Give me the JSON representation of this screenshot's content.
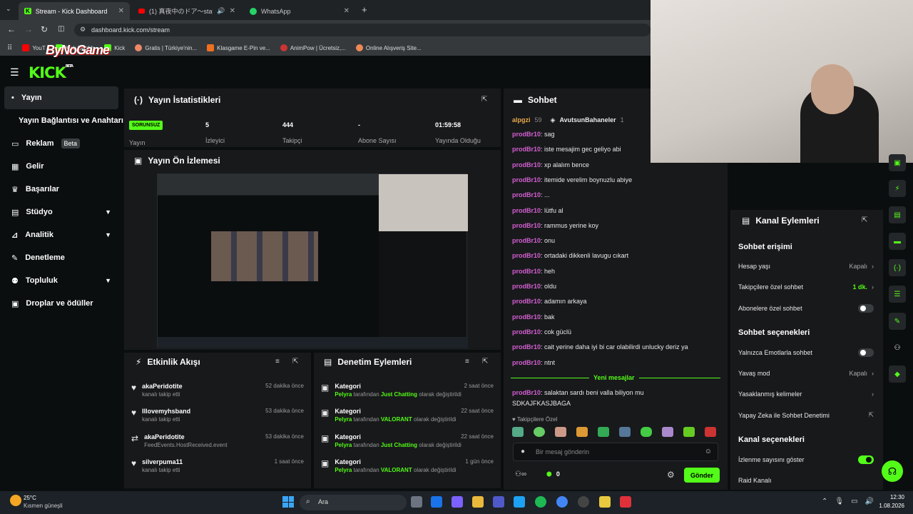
{
  "browser": {
    "tabs": [
      {
        "title": "Stream - Kick Dashboard"
      },
      {
        "title": "(1) 真夜中のドア〜stay with m"
      },
      {
        "title": "WhatsApp"
      }
    ],
    "url": "dashboard.kick.com/stream",
    "bookmarks": [
      "YouT",
      "Kick Dashb",
      "Kick",
      "Gratis | Türkiye'nin...",
      "Klasgame E-Pin ve...",
      "AnimPow | Ücretsiz,...",
      "Online Alışveriş Site..."
    ],
    "overlay_logo": "ByNoGame"
  },
  "app": {
    "logo": "KICK",
    "logo_sup": "BETA"
  },
  "sidebar": {
    "items": [
      {
        "label": "Yayın"
      },
      {
        "label": "Yayın Bağlantısı ve Anahtarı"
      },
      {
        "label": "Reklam",
        "badge": "Beta"
      },
      {
        "label": "Gelir"
      },
      {
        "label": "Başarılar"
      },
      {
        "label": "Stüdyo"
      },
      {
        "label": "Analitik"
      },
      {
        "label": "Denetleme"
      },
      {
        "label": "Topluluk"
      },
      {
        "label": "Droplar ve ödüller"
      }
    ]
  },
  "stats": {
    "title": "Yayın İstatistikleri",
    "badge": "SORUNSUZ",
    "status_label": "Yayın",
    "viewers": {
      "value": "5",
      "label": "İzleyici"
    },
    "followers": {
      "value": "444",
      "label": "Takipçi"
    },
    "subs": {
      "value": "-",
      "label": "Abone Sayısı"
    },
    "uptime": {
      "value": "01:59:58",
      "label": "Yayında Olduğu"
    }
  },
  "preview": {
    "title": "Yayın Ön İzlemesi"
  },
  "activity": {
    "title": "Etkinlik Akışı",
    "items": [
      {
        "name": "akaPeridotite",
        "desc": "kanalı takip etti",
        "time": "52 dakika önce"
      },
      {
        "name": "Illovemyhsband",
        "desc": "kanalı takip etti",
        "time": "53 dakika önce"
      },
      {
        "name": "akaPeridotite",
        "desc": "FeedEvents.HostReceived.event",
        "time": "53 dakika önce"
      },
      {
        "name": "silverpuma11",
        "desc": "kanalı takip etti",
        "time": "1 saat önce"
      }
    ]
  },
  "moderation": {
    "title": "Denetim Eylemleri",
    "items": [
      {
        "title": "Kategori",
        "user": "Pelyra",
        "mid": "tarafından",
        "cat": "Just Chatting",
        "end": "olarak değiştirildi",
        "time": "2 saat önce"
      },
      {
        "title": "Kategori",
        "user": "Pelyra",
        "mid": "tarafından",
        "cat": "VALORANT",
        "end": "olarak değiştirildi",
        "time": "22 saat önce"
      },
      {
        "title": "Kategori",
        "user": "Pelyra",
        "mid": "tarafından",
        "cat": "Just Chatting",
        "end": "olarak değiştirildi",
        "time": "22 saat önce"
      },
      {
        "title": "Kategori",
        "user": "Pelyra",
        "mid": "tarafından",
        "cat": "VALORANT",
        "end": "olarak değiştirildi",
        "time": "1 gün önce"
      }
    ]
  },
  "chat": {
    "title": "Sohbet",
    "pinned_user1": "alpgzi",
    "pinned_count1": "59",
    "pinned_user2": "AvutsunBahaneler",
    "pinned_count2": "1",
    "messages": [
      {
        "user": "prodBr10",
        "text": "sag"
      },
      {
        "user": "prodBr10",
        "text": "iste mesajim gec geliyo abi"
      },
      {
        "user": "prodBr10",
        "text": "xp alalım bence"
      },
      {
        "user": "prodBr10",
        "text": "itemide verelim boynuzlu abiye"
      },
      {
        "user": "prodBr10",
        "text": "..."
      },
      {
        "user": "prodBr10",
        "text": "lütfu al"
      },
      {
        "user": "prodBr10",
        "text": "rammus yerine koy"
      },
      {
        "user": "prodBr10",
        "text": "onu"
      },
      {
        "user": "prodBr10",
        "text": "ortadaki dikkenli lavugu cıkart"
      },
      {
        "user": "prodBr10",
        "text": "heh"
      },
      {
        "user": "prodBr10",
        "text": "oldu"
      },
      {
        "user": "prodBr10",
        "text": "adamın arkaya"
      },
      {
        "user": "prodBr10",
        "text": "bak"
      },
      {
        "user": "prodBr10",
        "text": "cok güclü"
      },
      {
        "user": "prodBr10",
        "text": "cait yerine daha iyi bi car olabilirdi unlucky deriz ya"
      },
      {
        "user": "prodBr10",
        "text": "ntnt"
      }
    ],
    "new_messages": "Yeni mesajlar",
    "last_user": "prodBr10",
    "last_text": "salaktan sardı beni valla biliyon mu",
    "last_text2": "SDKAJFKASJBAGA",
    "emote_label": "Takipçilere Özel",
    "placeholder": "Bir mesaj gönderin",
    "points": "0",
    "send": "Gönder"
  },
  "channel_actions": {
    "title": "Kanal Eylemleri",
    "chat_access": "Sohbet erişimi",
    "account_age": {
      "label": "Hesap yaşı",
      "value": "Kapalı"
    },
    "followers_only": {
      "label": "Takipçilere özel sohbet",
      "value": "1 dk."
    },
    "subs_only": {
      "label": "Abonelere özel sohbet"
    },
    "chat_options": "Sohbet seçenekleri",
    "emote_only": {
      "label": "Yalnızca Emotlarla sohbet"
    },
    "slow_mode": {
      "label": "Yavaş mod",
      "value": "Kapalı"
    },
    "banned_words": {
      "label": "Yasaklanmış kelimeler"
    },
    "ai_mod": {
      "label": "Yapay Zeka ile Sohbet Denetimi"
    },
    "channel_options": "Kanal seçenekleri",
    "show_views": {
      "label": "İzlenme sayısını göster"
    },
    "raid": {
      "label": "Raid Kanalı"
    }
  },
  "taskbar": {
    "temp": "25°C",
    "weather": "Kısmen güneşli",
    "search": "Ara",
    "time": "12:30",
    "date": "1.08.2026"
  },
  "colors": {
    "accent": "#53fc18",
    "username": "#d35fd1",
    "panel": "#18191b"
  }
}
